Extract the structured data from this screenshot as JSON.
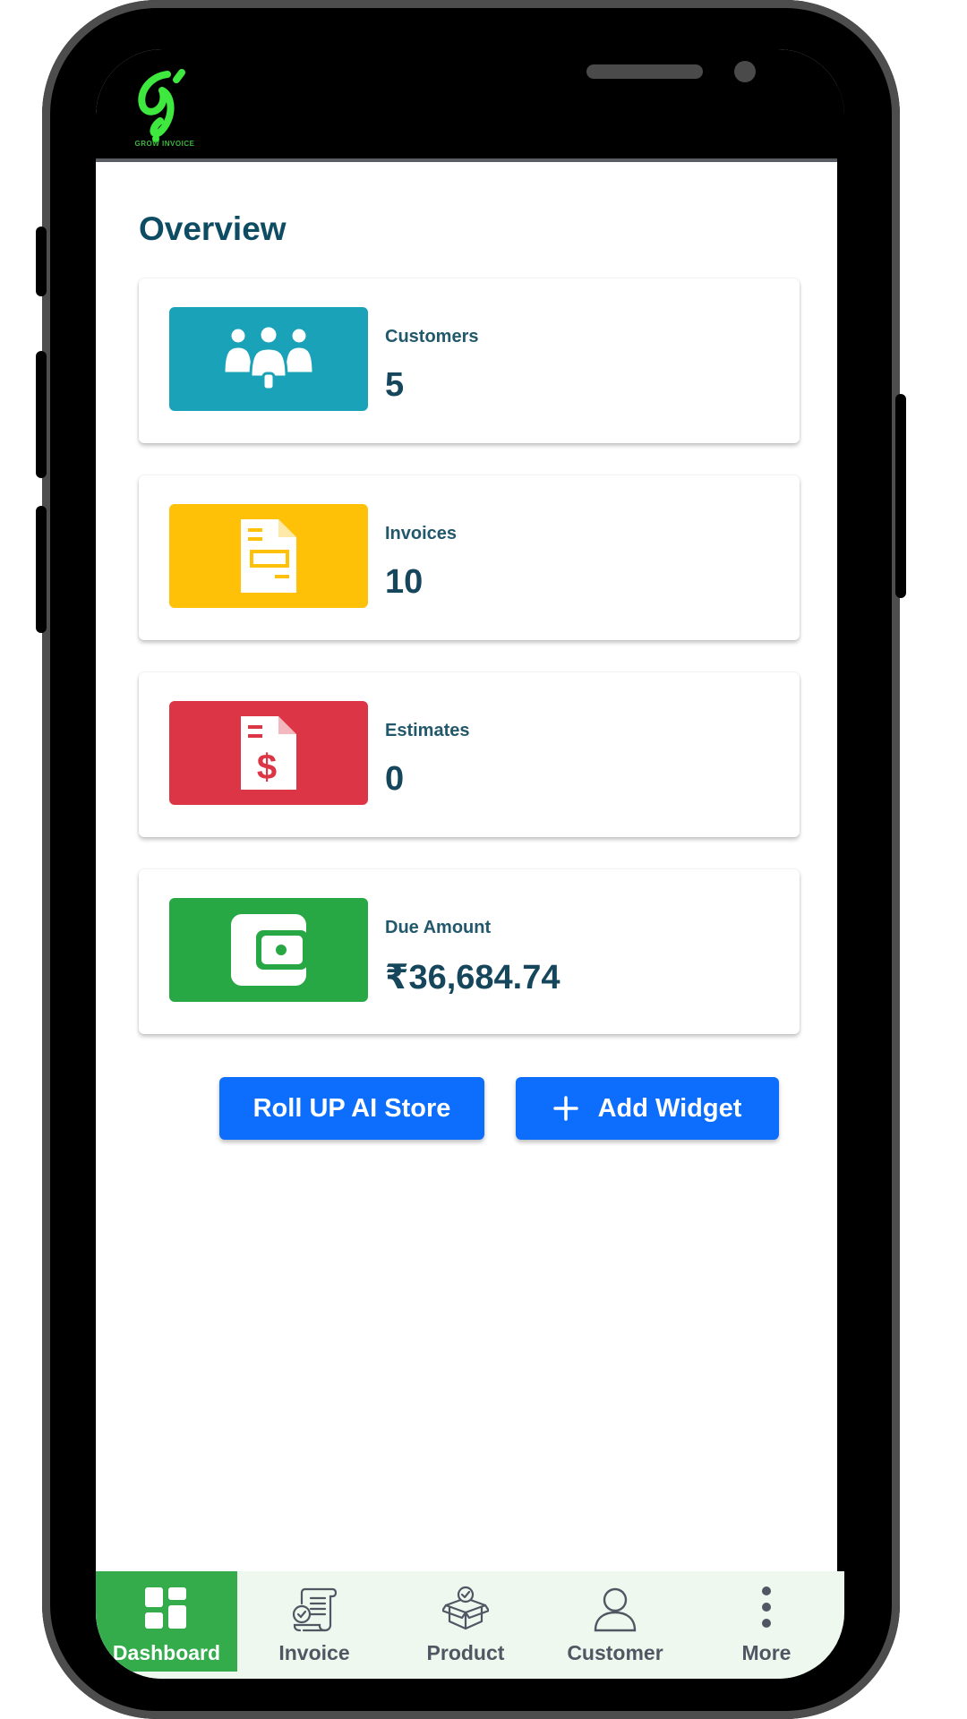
{
  "app": {
    "logo_text": "GROW INVOICE"
  },
  "overview": {
    "title": "Overview",
    "cards": [
      {
        "label": "Customers",
        "value": "5",
        "icon": "customers-group-icon",
        "color": "#19a2b8"
      },
      {
        "label": "Invoices",
        "value": "10",
        "icon": "invoice-document-icon",
        "color": "#ffc107"
      },
      {
        "label": "Estimates",
        "value": "0",
        "icon": "estimate-dollar-document-icon",
        "color": "#dc3545"
      },
      {
        "label": "Due Amount",
        "value": "₹36,684.74",
        "icon": "wallet-icon",
        "color": "#28a745"
      }
    ]
  },
  "actions": {
    "rollup_label": "Roll UP AI Store",
    "add_widget_label": "Add Widget",
    "add_icon": "plus-icon",
    "color": "#0d6efd"
  },
  "nav": {
    "items": [
      {
        "label": "Dashboard",
        "icon": "dashboard-grid-icon",
        "active": true
      },
      {
        "label": "Invoice",
        "icon": "invoice-scroll-icon"
      },
      {
        "label": "Product",
        "icon": "product-box-icon"
      },
      {
        "label": "Customer",
        "icon": "customer-user-icon"
      },
      {
        "label": "More",
        "icon": "more-vertical-icon"
      }
    ],
    "active_color": "#34ac4c"
  }
}
